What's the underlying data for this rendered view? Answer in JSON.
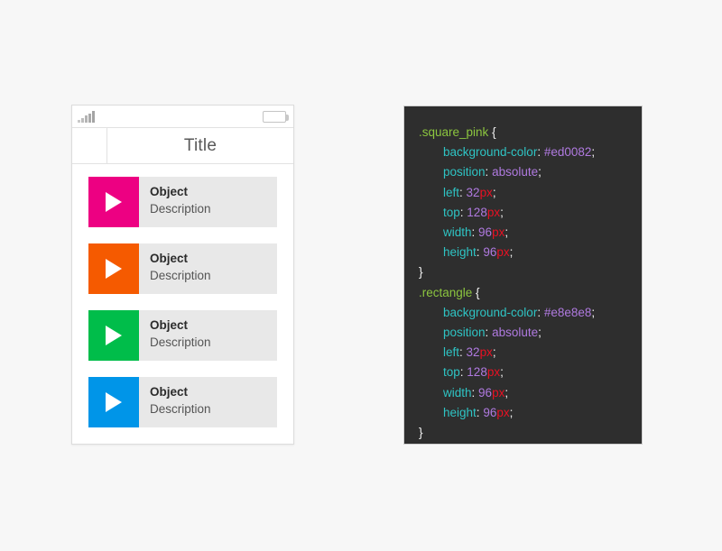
{
  "page": {
    "background_color": "#f7f7f7"
  },
  "phone": {
    "status_bar": {
      "signal_icon": "signal-bars-icon",
      "signal_bars": 5,
      "battery_icon": "battery-full-icon"
    },
    "title_bar": {
      "title": "Title",
      "back_cell_label": ""
    },
    "list_items": [
      {
        "title": "Object",
        "description": "Description",
        "color": "#ed0082",
        "icon": "play-icon"
      },
      {
        "title": "Object",
        "description": "Description",
        "color": "#f55a00",
        "icon": "play-icon"
      },
      {
        "title": "Object",
        "description": "Description",
        "color": "#00bd4a",
        "icon": "play-icon"
      },
      {
        "title": "Object",
        "description": "Description",
        "color": "#0095e8",
        "icon": "play-icon"
      }
    ],
    "row_background_color": "#e8e8e8"
  },
  "code_panel": {
    "background_color": "#2e2e2e",
    "syntax_colors": {
      "selector": "#8cc63f",
      "property": "#2ec4c4",
      "value": "#b07ae0",
      "unit": "#e81123",
      "punctuation": "#f2f2f2"
    },
    "lines": [
      {
        "indent": false,
        "selector": ".square_pink",
        "brace": " {"
      },
      {
        "indent": true,
        "prop": "background-color",
        "colon": ": ",
        "value": "#ed0082",
        "unit": "",
        "semi": ";"
      },
      {
        "indent": true,
        "prop": "position",
        "colon": ": ",
        "value": "absolute",
        "unit": "",
        "semi": ";"
      },
      {
        "indent": true,
        "prop": "left",
        "colon": ": ",
        "value": "32",
        "unit": "px",
        "semi": ";"
      },
      {
        "indent": true,
        "prop": "top",
        "colon": ": ",
        "value": "128",
        "unit": "px",
        "semi": ";"
      },
      {
        "indent": true,
        "prop": "width",
        "colon": ": ",
        "value": "96",
        "unit": "px",
        "semi": ";"
      },
      {
        "indent": true,
        "prop": "height",
        "colon": ": ",
        "value": "96",
        "unit": "px",
        "semi": ";"
      },
      {
        "indent": false,
        "brace": "}"
      },
      {
        "indent": false,
        "selector": ".rectangle",
        "brace": " {"
      },
      {
        "indent": true,
        "prop": "background-color",
        "colon": ": ",
        "value": "#e8e8e8",
        "unit": "",
        "semi": ";"
      },
      {
        "indent": true,
        "prop": "position",
        "colon": ": ",
        "value": "absolute",
        "unit": "",
        "semi": ";"
      },
      {
        "indent": true,
        "prop": "left",
        "colon": ": ",
        "value": "32",
        "unit": "px",
        "semi": ";"
      },
      {
        "indent": true,
        "prop": "top",
        "colon": ": ",
        "value": "128",
        "unit": "px",
        "semi": ";"
      },
      {
        "indent": true,
        "prop": "width",
        "colon": ": ",
        "value": "96",
        "unit": "px",
        "semi": ";"
      },
      {
        "indent": true,
        "prop": "height",
        "colon": ": ",
        "value": "96",
        "unit": "px",
        "semi": ";"
      },
      {
        "indent": false,
        "brace": "}"
      }
    ]
  }
}
